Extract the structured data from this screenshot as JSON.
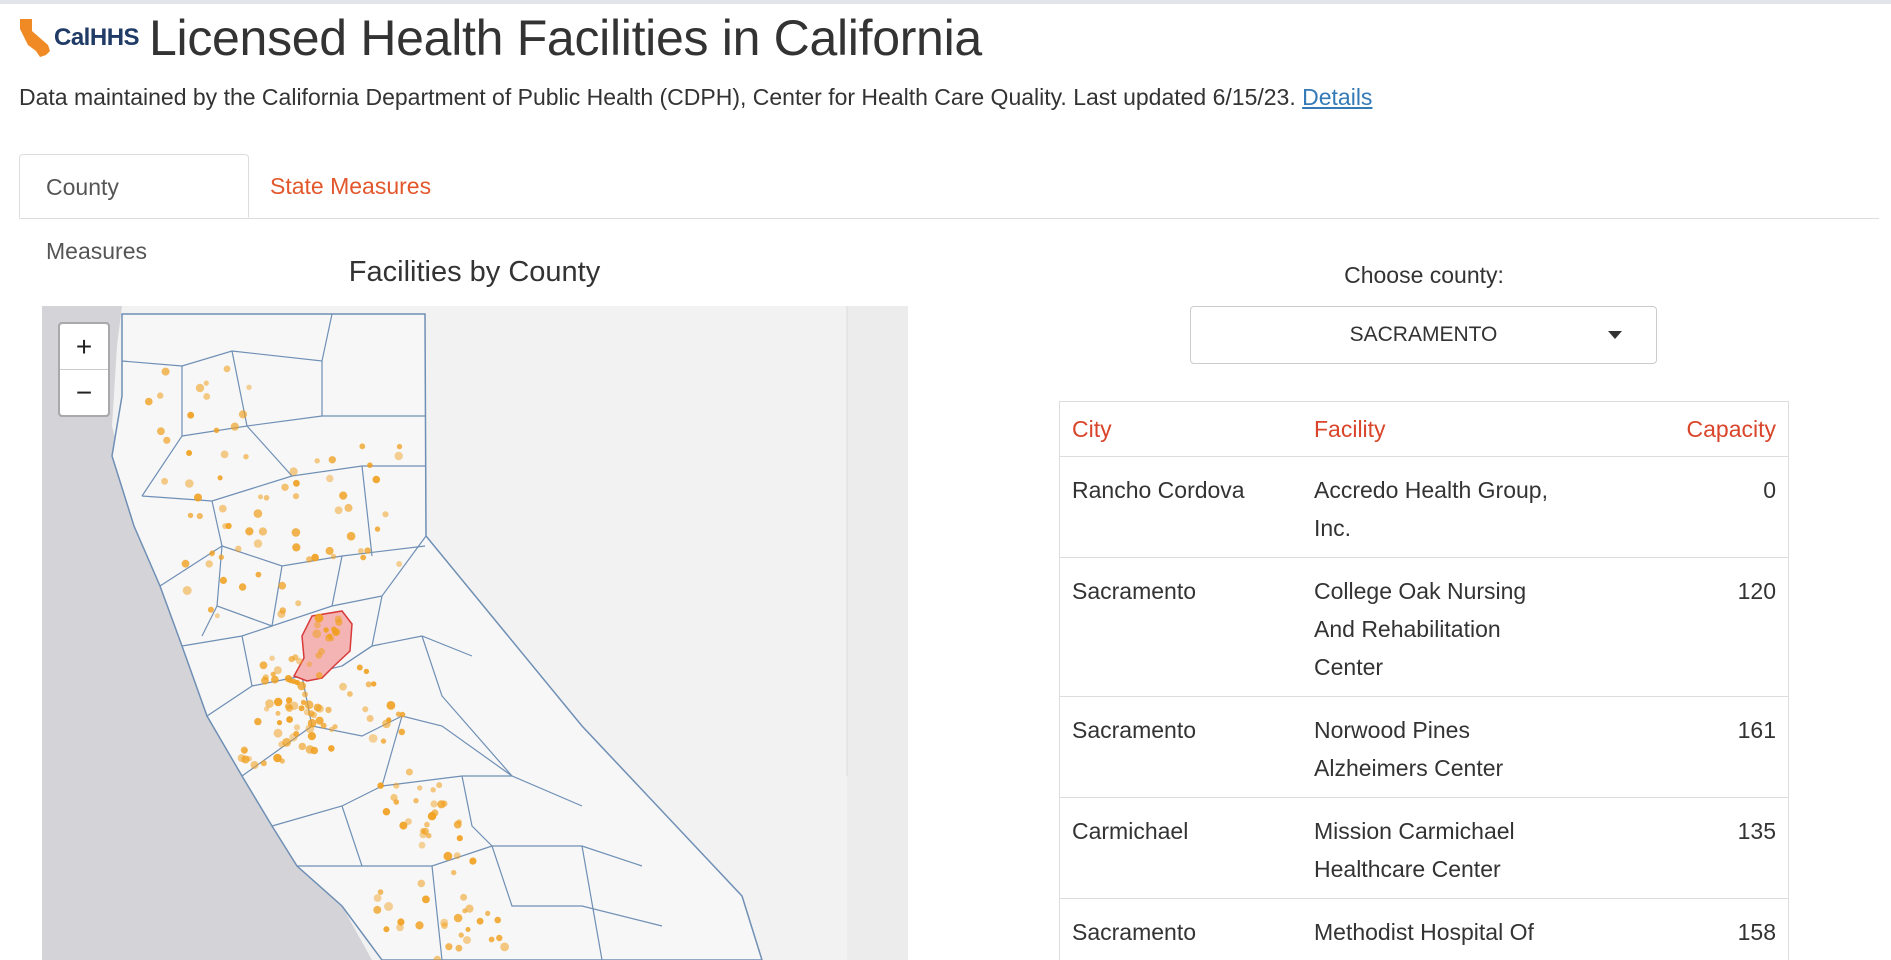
{
  "header": {
    "logo_text_cal": "Cal",
    "logo_text_hhs": "HHS",
    "title": "Licensed Health Facilities in California",
    "subtitle": "Data maintained by the California Department of Public Health (CDPH), Center for Health Care Quality. Last updated 6/15/23.",
    "details_link": "Details"
  },
  "tabs": [
    {
      "label": "County Measures",
      "active": true
    },
    {
      "label": "State Measures",
      "active": false
    }
  ],
  "map": {
    "title": "Facilities by County",
    "zoom_in": "+",
    "zoom_out": "−",
    "highlighted_county": "SACRAMENTO",
    "dot_color": "#f0a020",
    "highlight_color": "#e04040"
  },
  "county_select": {
    "label": "Choose county:",
    "value": "SACRAMENTO"
  },
  "table": {
    "headers": {
      "city": "City",
      "facility": "Facility",
      "capacity": "Capacity"
    },
    "rows": [
      {
        "city": "Rancho Cordova",
        "facility": "Accredo Health Group, Inc.",
        "capacity": "0"
      },
      {
        "city": "Sacramento",
        "facility": "College Oak Nursing And Rehabilitation Center",
        "capacity": "120"
      },
      {
        "city": "Sacramento",
        "facility": "Norwood Pines Alzheimers Center",
        "capacity": "161"
      },
      {
        "city": "Carmichael",
        "facility": "Mission Carmichael Healthcare Center",
        "capacity": "135"
      },
      {
        "city": "Sacramento",
        "facility": "Methodist Hospital Of Sacramento",
        "capacity": "158"
      }
    ]
  }
}
